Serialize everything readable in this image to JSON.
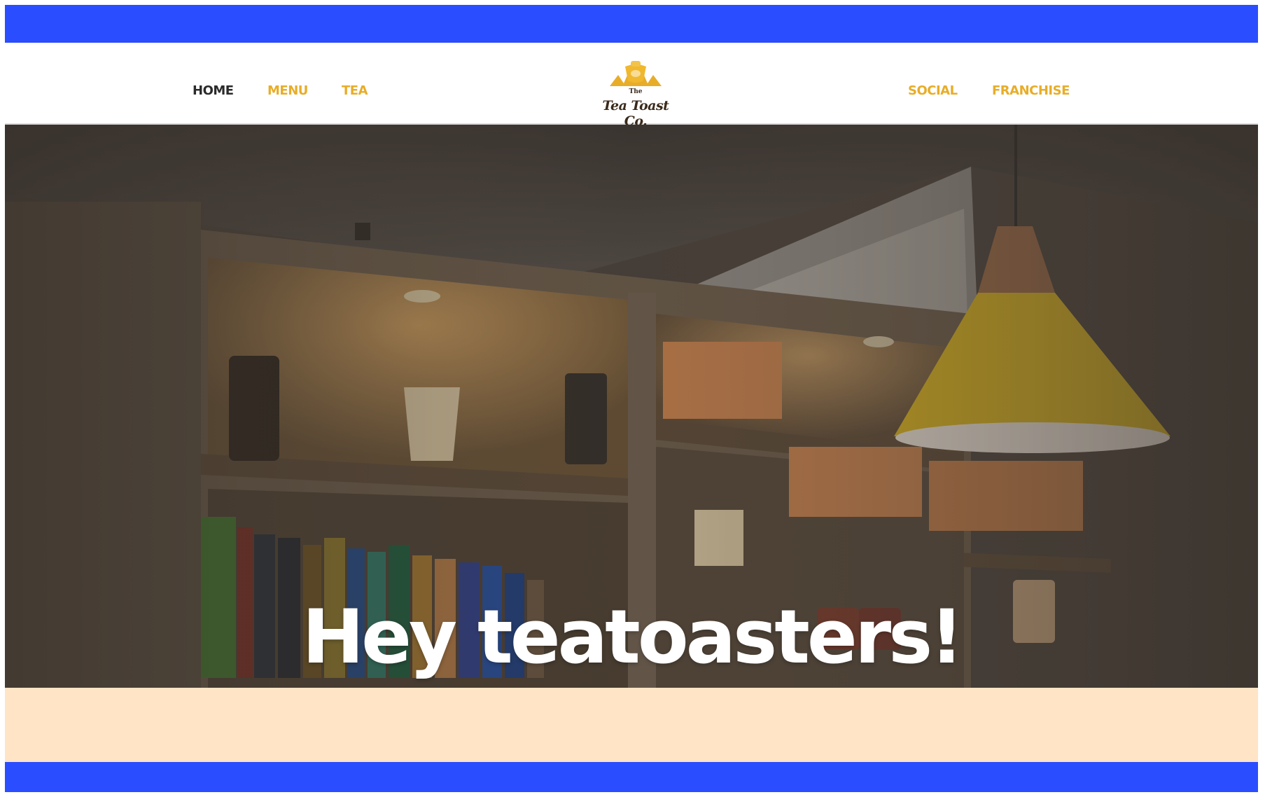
{
  "nav": {
    "home": "HOME",
    "menu": "MENU",
    "tea": "TEA",
    "social": "SOCIAL",
    "franchise": "FRANCHISE"
  },
  "logo": {
    "small_text": "The",
    "brand": "Tea Toast Co."
  },
  "hero": {
    "headline": "Hey teatoasters!"
  },
  "colors": {
    "band_blue": "#2a4dff",
    "nav_accent": "#e8ad28",
    "nav_active": "#2b2b2b",
    "peach": "#ffe4c6",
    "lamp_yellow": "#d9b521"
  }
}
